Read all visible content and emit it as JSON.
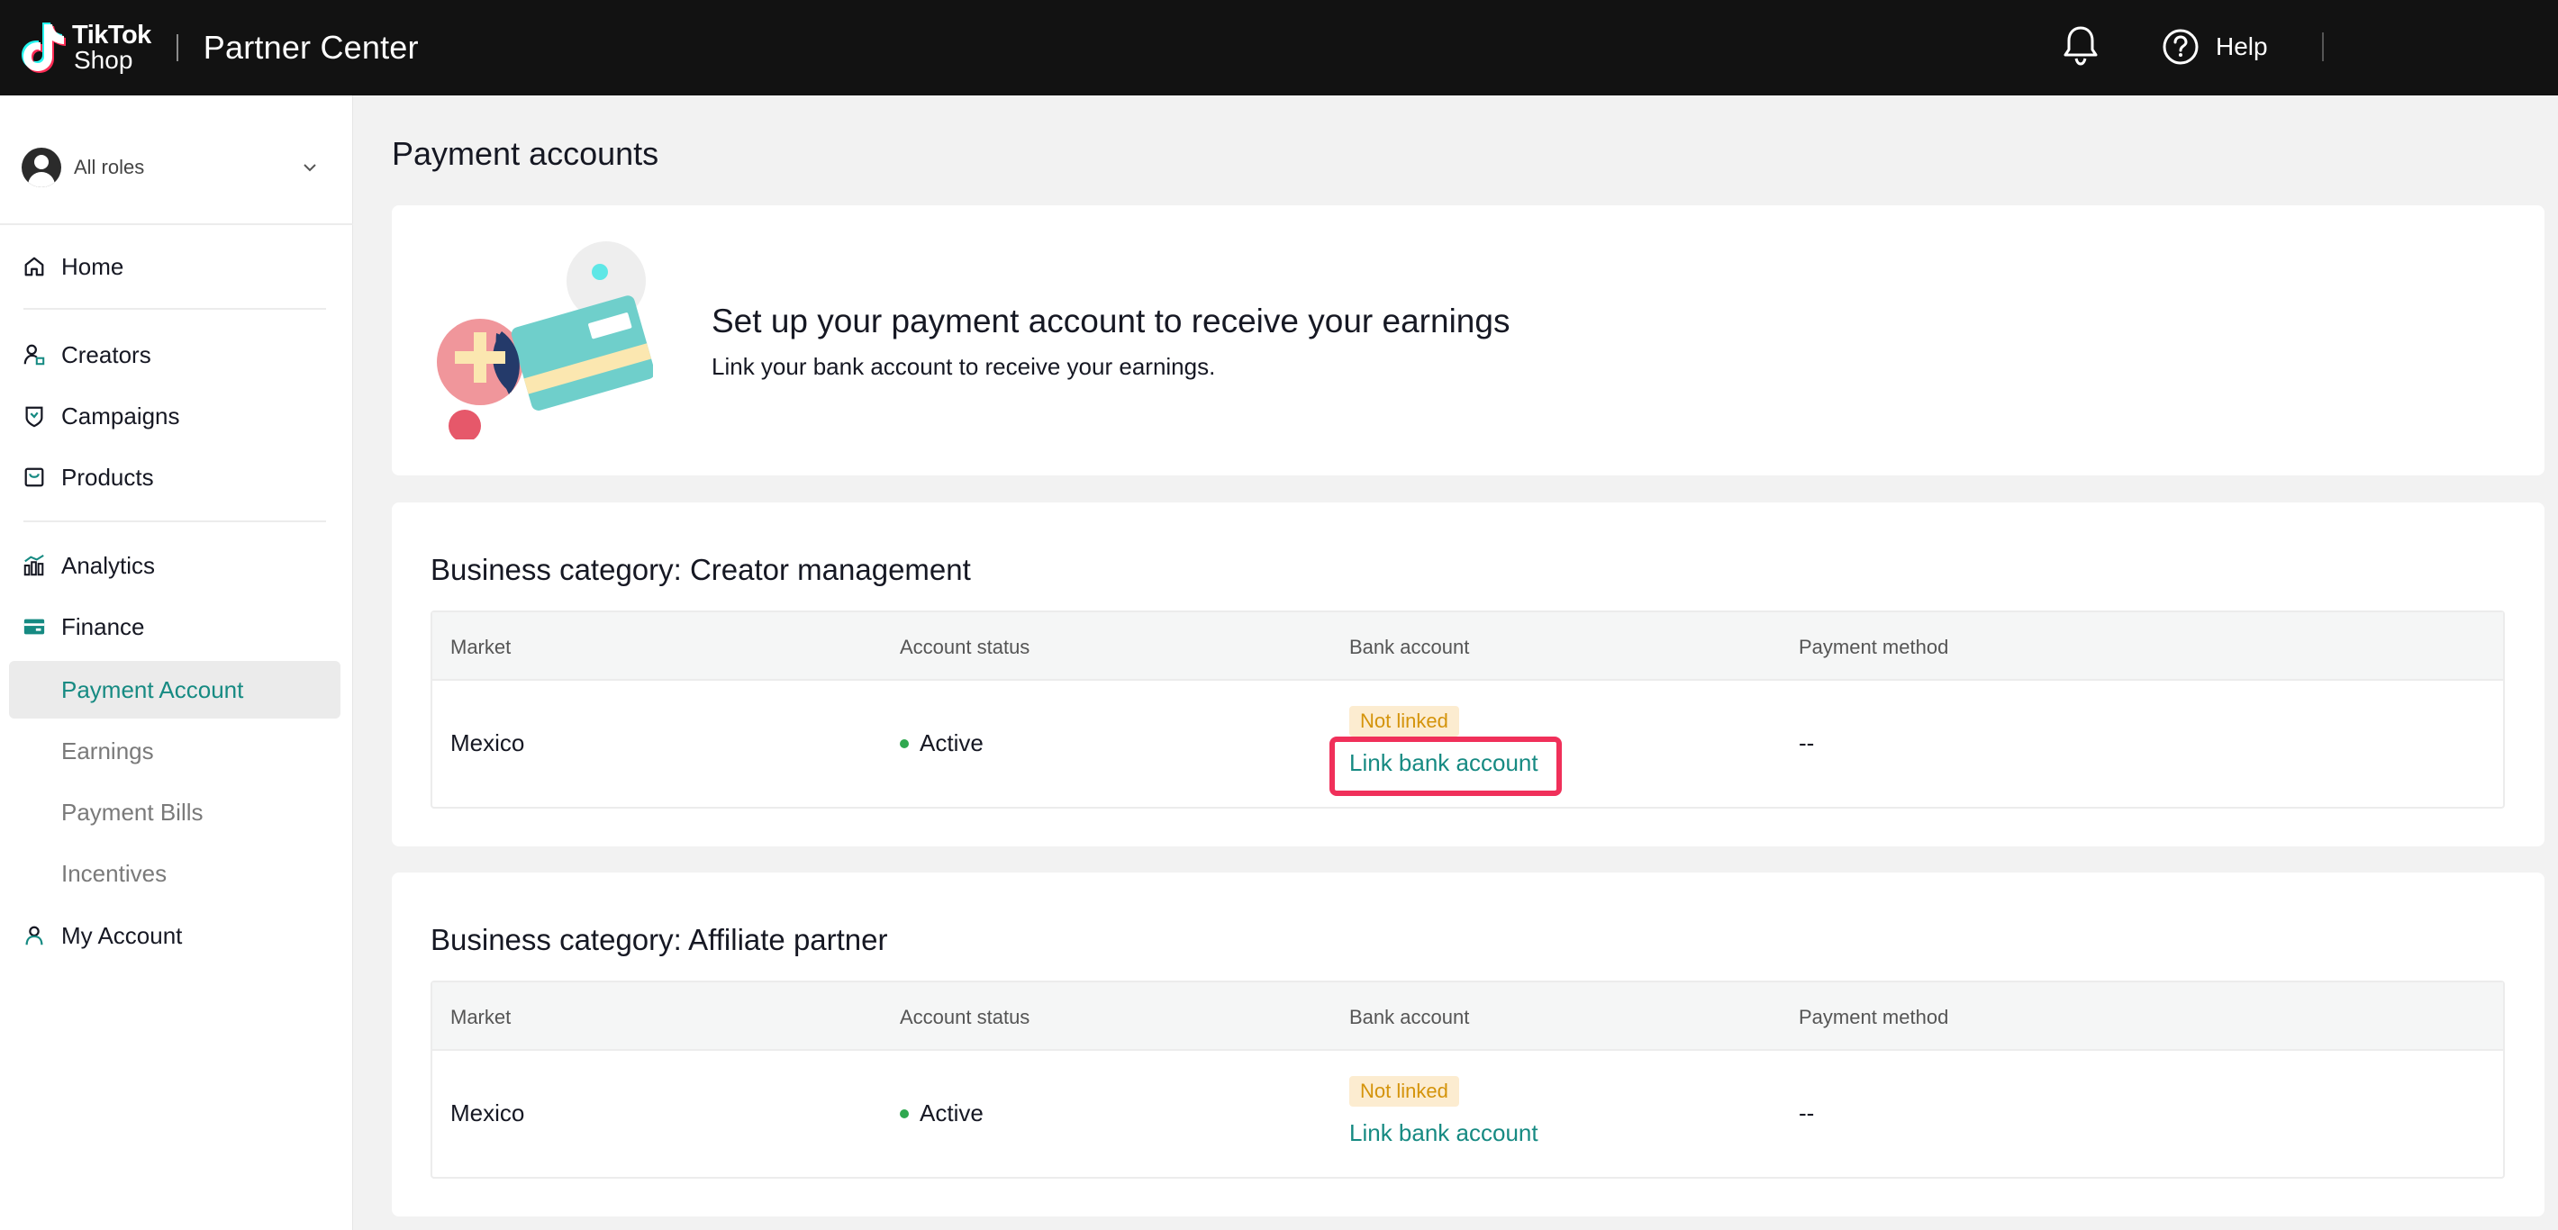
{
  "header": {
    "logo_line1": "TikTok",
    "logo_line2": "Shop",
    "app_title": "Partner Center",
    "help_label": "Help"
  },
  "sidebar": {
    "role_label": "All roles",
    "nav": {
      "home": "Home",
      "creators": "Creators",
      "campaigns": "Campaigns",
      "products": "Products",
      "analytics": "Analytics",
      "finance": "Finance",
      "my_account": "My Account"
    },
    "finance_sub": {
      "payment_account": "Payment Account",
      "earnings": "Earnings",
      "payment_bills": "Payment Bills",
      "incentives": "Incentives"
    },
    "active_item": "Payment Account"
  },
  "main": {
    "page_title": "Payment accounts",
    "banner": {
      "title": "Set up your payment account to receive your earnings",
      "subtitle": "Link your bank account to receive your earnings."
    },
    "columns": [
      "Market",
      "Account status",
      "Bank account",
      "Payment method"
    ],
    "sections": [
      {
        "title": "Business category: Creator management",
        "row": {
          "market": "Mexico",
          "status": "Active",
          "bank_badge": "Not linked",
          "bank_link": "Link bank account",
          "payment_method": "--"
        }
      },
      {
        "title": "Business category: Affiliate partner",
        "row": {
          "market": "Mexico",
          "status": "Active",
          "bank_badge": "Not linked",
          "bank_link": "Link bank account",
          "payment_method": "--"
        }
      }
    ]
  },
  "colors": {
    "accent": "#168a82",
    "highlight": "#f0305a",
    "status_active": "#2fa84f",
    "badge_bg": "#fcecd0",
    "badge_text": "#d4930a"
  }
}
